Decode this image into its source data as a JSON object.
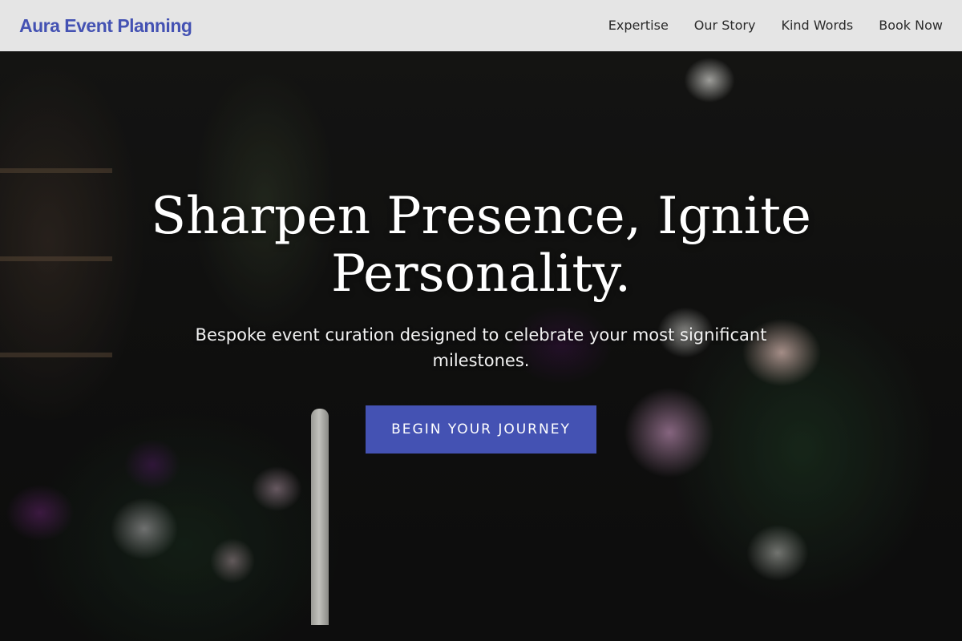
{
  "brand": {
    "name": "Aura Event Planning",
    "color": "#4452b3"
  },
  "nav": {
    "links": [
      {
        "label": "Expertise"
      },
      {
        "label": "Our Story"
      },
      {
        "label": "Kind Words"
      },
      {
        "label": "Book Now"
      }
    ]
  },
  "hero": {
    "title": "Sharpen Presence, Ignite Personality.",
    "subtitle": "Bespoke event curation designed to celebrate your most significant milestones.",
    "cta_label": "BEGIN YOUR JOURNEY",
    "cta_color": "#4452b3"
  }
}
